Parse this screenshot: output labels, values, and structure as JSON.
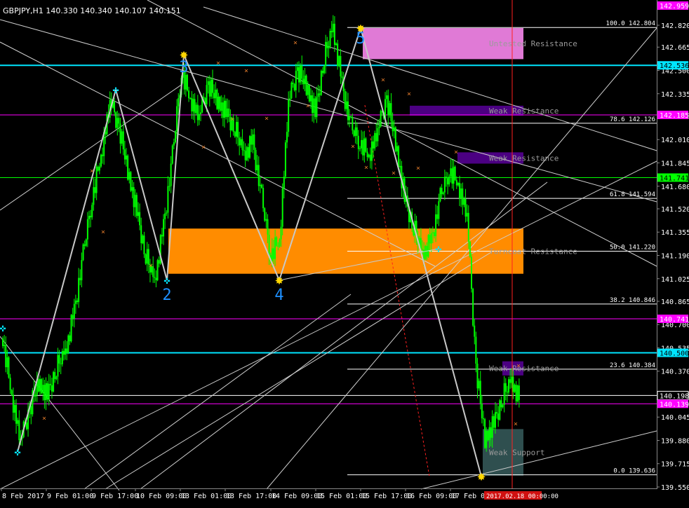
{
  "header": {
    "symbol_info": "GBPJPY,H1  140.330 140.340 140.107 140.151"
  },
  "colors": {
    "background": "#000000",
    "candles": "#00ff00",
    "cyan_line": "#00e5ff",
    "magenta_line": "#ff00ff",
    "green_line": "#00ff00",
    "orange_zone": "#ff8c00",
    "pink_zone": "#e07ad6",
    "purple_zone": "#4b0082",
    "support_zone": "#2f4f4f",
    "white_line": "#ffffff",
    "cursor_red": "#ff2020"
  },
  "price_axis": {
    "ticks": [
      "142.820",
      "142.665",
      "142.500",
      "142.335",
      "142.180",
      "142.010",
      "141.845",
      "141.680",
      "141.520",
      "141.355",
      "141.190",
      "141.025",
      "140.865",
      "140.700",
      "140.535",
      "140.370",
      "140.205",
      "140.045",
      "139.880",
      "139.715",
      "139.550"
    ],
    "highlighted": [
      {
        "value": "142.959",
        "color": "#ff00ff",
        "text_color": "#ffffff",
        "price": 142.959
      },
      {
        "value": "142.536",
        "color": "#00e5ff",
        "text_color": "#000000",
        "price": 142.536
      },
      {
        "value": "142.185",
        "color": "#ff00ff",
        "text_color": "#ffffff",
        "price": 142.185
      },
      {
        "value": "141.741",
        "color": "#00ff00",
        "text_color": "#000000",
        "price": 141.741
      },
      {
        "value": "140.741",
        "color": "#ff00ff",
        "text_color": "#ffffff",
        "price": 140.741
      },
      {
        "value": "140.500",
        "color": "#00e5ff",
        "text_color": "#000000",
        "price": 140.5
      },
      {
        "value": "140.198",
        "color": "#000000",
        "text_color": "#ffffff",
        "price": 140.198
      },
      {
        "value": "140.139",
        "color": "#ff00ff",
        "text_color": "#ffffff",
        "price": 140.139
      }
    ],
    "min": 139.55,
    "max": 142.959
  },
  "time_axis": {
    "labels": [
      "8 Feb 2017",
      "9 Feb 01:00",
      "9 Feb 17:00",
      "10 Feb 09:00",
      "13 Feb 01:00",
      "13 Feb 17:00",
      "14 Feb 09:00",
      "15 Feb 01:00",
      "15 Feb 17:00",
      "16 Feb 09:00",
      "17 Feb 01:00"
    ],
    "cursor_label": "2017.02.18 00:00:00"
  },
  "fibonacci": [
    {
      "label": "100.0 142.804",
      "price": 142.804
    },
    {
      "label": "78.6 142.126",
      "price": 142.126
    },
    {
      "label": "61.8 141.594",
      "price": 141.594
    },
    {
      "label": "50.0 141.220",
      "price": 141.22
    },
    {
      "label": "38.2 140.846",
      "price": 140.846
    },
    {
      "label": "23.6 140.384",
      "price": 140.384
    },
    {
      "label": "0.0 139.636",
      "price": 139.636
    }
  ],
  "zones": [
    {
      "label": "Untested Resistance",
      "kind": "pink",
      "top": 142.8,
      "bottom": 142.58
    },
    {
      "label": "Weak Resistance",
      "kind": "purple",
      "top": 142.25,
      "bottom": 142.18
    },
    {
      "label": "Weak Resistance",
      "kind": "purple",
      "top": 141.92,
      "bottom": 141.84
    },
    {
      "label": "Turncoat Resistance",
      "kind": "orange",
      "top": 141.38,
      "bottom": 141.06
    },
    {
      "label": "Weak Resistance",
      "kind": "purple",
      "top": 140.44,
      "bottom": 140.34
    },
    {
      "label": "Weak Support",
      "kind": "support",
      "top": 139.96,
      "bottom": 139.63
    }
  ],
  "wave_labels": [
    "2",
    "3",
    "4",
    "5"
  ],
  "chart_data": {
    "type": "candlestick",
    "symbol": "GBPJPY",
    "timeframe": "H1",
    "ohlc_header": {
      "open": 140.33,
      "high": 140.34,
      "low": 140.107,
      "close": 140.151
    },
    "ylim": [
      139.55,
      142.959
    ],
    "close_series": [
      140.6,
      140.2,
      139.9,
      140.1,
      140.3,
      140.2,
      140.4,
      140.5,
      140.8,
      141.2,
      141.6,
      141.9,
      142.3,
      142.1,
      141.8,
      141.5,
      141.2,
      141.0,
      141.4,
      141.9,
      142.5,
      142.3,
      142.2,
      142.4,
      142.3,
      142.2,
      142.1,
      141.9,
      142.0,
      141.6,
      141.2,
      141.3,
      142.3,
      142.5,
      142.4,
      142.2,
      142.6,
      142.8,
      142.4,
      142.1,
      142.0,
      141.9,
      142.1,
      142.3,
      142.0,
      141.6,
      141.4,
      141.2,
      141.3,
      141.6,
      141.8,
      141.7,
      141.5,
      140.4,
      139.9,
      140.0,
      140.2,
      140.3,
      140.15
    ]
  }
}
